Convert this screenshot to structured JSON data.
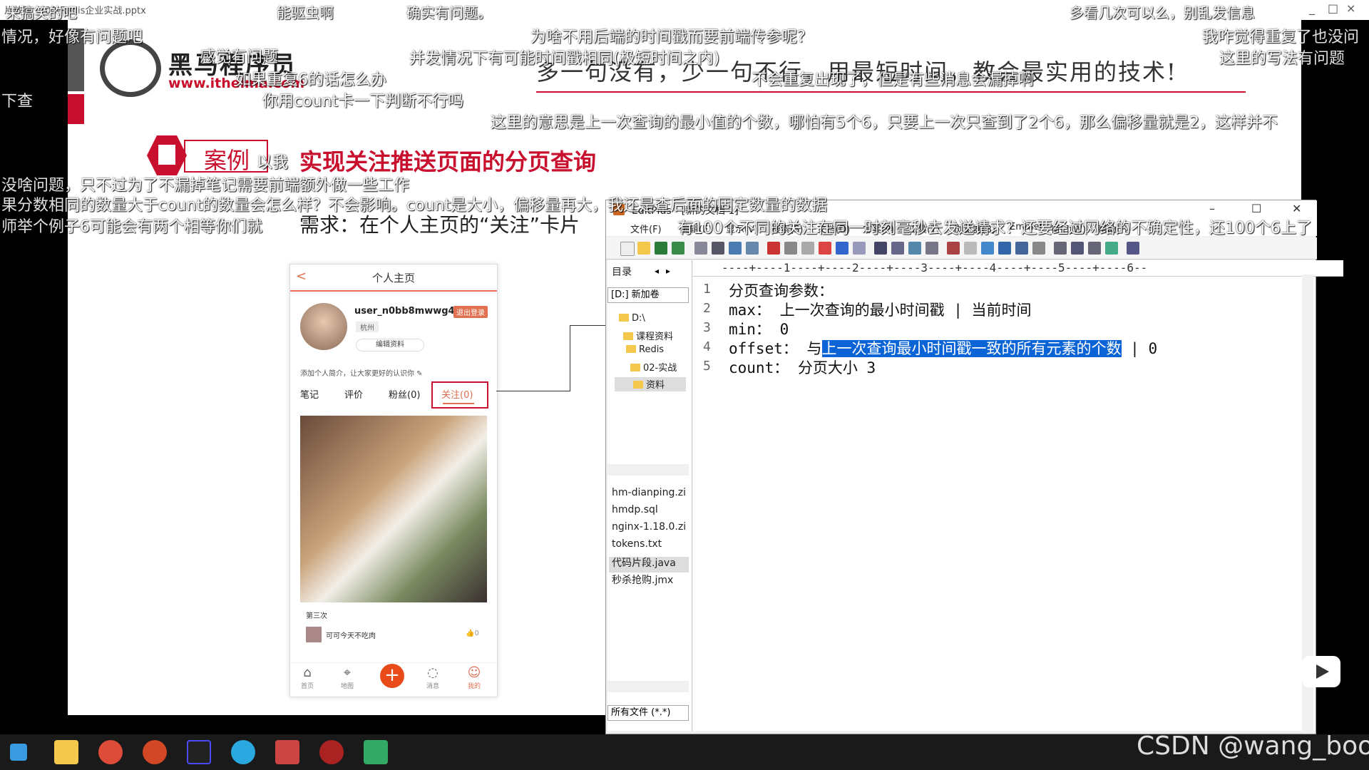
{
  "window": {
    "title": "片放映 - [02-Redis企业实战.pptx",
    "controls": [
      "_",
      "□",
      "×"
    ]
  },
  "slide": {
    "logo_name": "黑马程序员",
    "logo_url": "www.itheima.com",
    "slogan": "多一句没有，少一句不行，用最短时间，教会最实用的技术!",
    "case_label": "案例",
    "case_title": "实现关注推送页面的分页查询",
    "requirement": "需求：在个人主页的“关注”卡片"
  },
  "phone": {
    "title": "个人主页",
    "back": "<",
    "username": "user_n0bb8mwwg4",
    "logout": "退出登录",
    "city": "杭州",
    "edit_profile": "编辑资料",
    "bio": "添加个人简介，让大家更好的认识你 ✎",
    "tabs": [
      "笔记",
      "评价",
      "粉丝(0)"
    ],
    "follow_tab": "关注(0)",
    "post_caption": "第三次",
    "post_user": "可可今天不吃肉",
    "post_likes": "0",
    "nav": [
      "首页",
      "地图",
      "消息",
      "我的"
    ],
    "nav_add": "+"
  },
  "editplus": {
    "title": "EditPlus - [新的文档 1]",
    "menu": [
      "文件(F)",
      "编辑(E)",
      "显示(V)",
      "搜索(S)",
      "文档(D)",
      "方案(P)",
      "工具(T)",
      "浏览器(B)",
      "Emmet",
      "窗口(W)",
      "帮助(H)"
    ],
    "side_header": "目录",
    "drive": "[D:] 新加卷",
    "tree": [
      "D:\\",
      "课程资料",
      "Redis",
      "02-实战",
      "资料"
    ],
    "files": [
      "hm-dianping.zi",
      "hmdp.sql",
      "nginx-1.18.0.zi",
      "tokens.txt",
      "代码片段.java",
      "秒杀抢购.jmx"
    ],
    "filter": "所有文件 (*.*)",
    "ruler": "----+----1----+----2----+----3----+----4----+----5----+----6--",
    "lines": [
      {
        "num": "1",
        "text": "分页查询参数："
      },
      {
        "num": "2",
        "text": "max： 上一次查询的最小时间戳 | 当前时间"
      },
      {
        "num": "3",
        "text": "min： 0"
      },
      {
        "num": "4",
        "pre": "offset： 与",
        "hl": "上一次查询最小时间戳一致的所有元素的个数",
        "post": " | 0"
      },
      {
        "num": "5",
        "text": "count： 分页大小 3"
      }
    ]
  },
  "danmaku": [
    "来搞笑的吧",
    "能驱虫啊",
    "确实有问题。",
    "多看几次可以么，别乱发信息",
    "情况，好像有问题吧",
    "为啥不用后端的时间戳而要前端传参呢？",
    "我咋觉得重复了也没问",
    "感觉有问题",
    "并发情况下有可能时间戳相同(极短时间之内)",
    "这里的写法有问题",
    "如果重复6的话怎么办",
    "不会重复出现了，但是有些消息会漏掉啊",
    "下查",
    "你用count卡一下判断不行吗",
    "这里的意思是上一次查询的最小值的个数，哪怕有5个6，只要上一次只查到了2个6，那么偏移量就是2，这样并不",
    "以我",
    "没啥问题，只不过为了不漏掉笔记需要前端额外做一些工作",
    "果分数相同的数量大于count的数量会怎么样？不会影响。count是大小，偏移量再大，我还是查后面的固定数量的数据",
    "师举个例子6可能会有两个相等你们就",
    "有100个不同的关注在同一时刻毫秒去发送请求？还要经过网络的不确定性，还100个6上了"
  ],
  "watermark": "CSDN @wang_book"
}
